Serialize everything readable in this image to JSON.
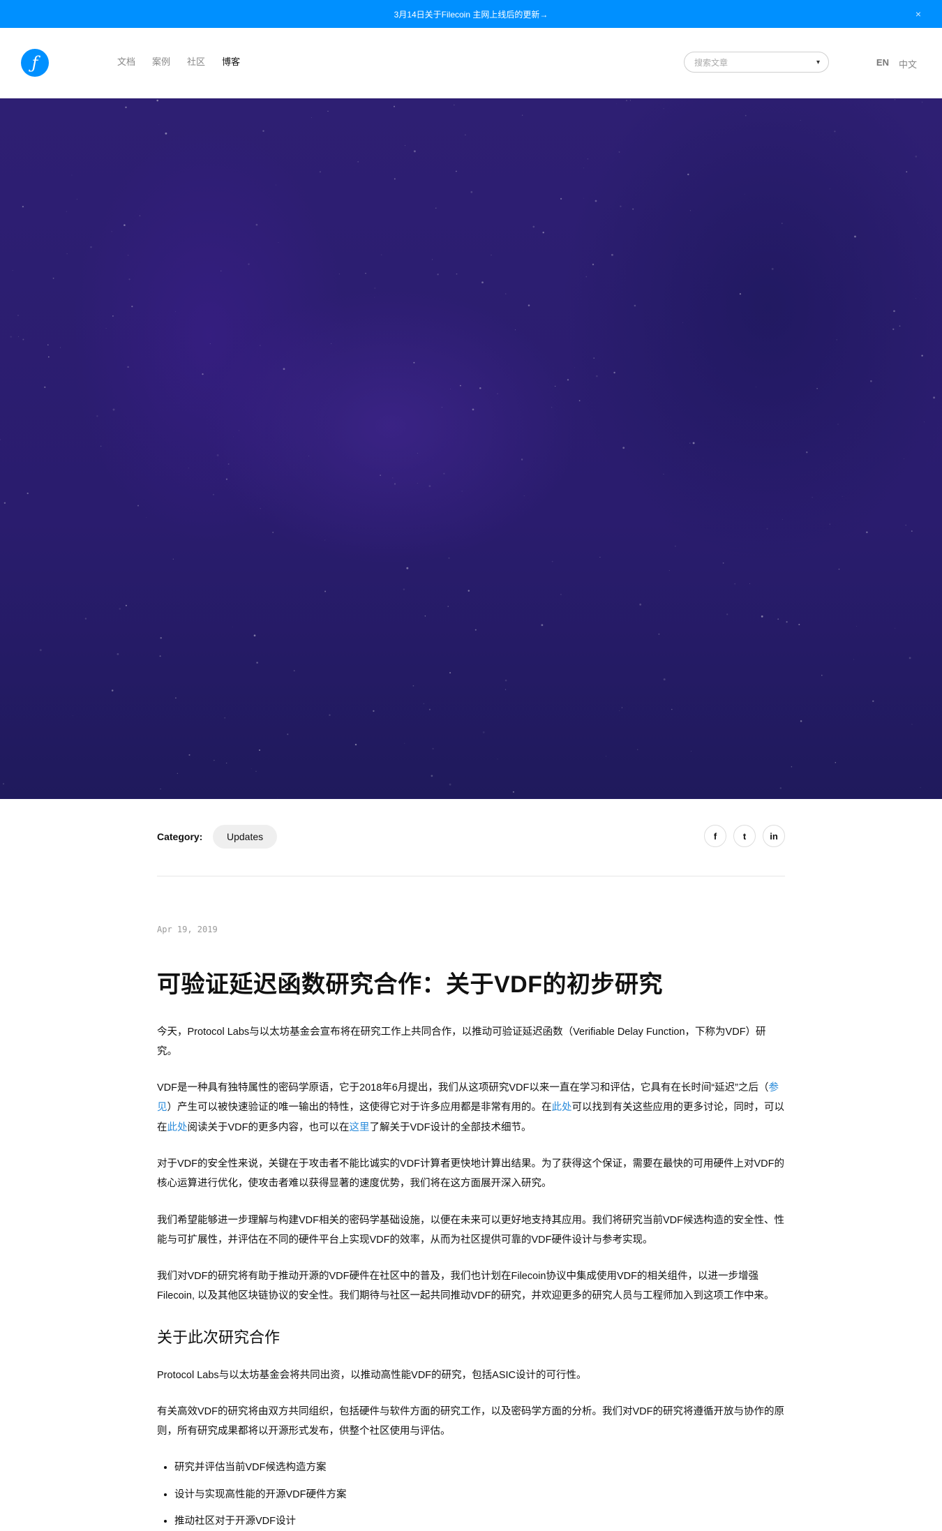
{
  "banner": {
    "text": "3月14日关于Filecoin 主网上线后的更新→",
    "close_glyph": "×"
  },
  "header": {
    "logo_glyph": "ƒ",
    "nav": [
      {
        "label": "文档",
        "active": false
      },
      {
        "label": "案例",
        "active": false
      },
      {
        "label": "社区",
        "active": false
      },
      {
        "label": "博客",
        "active": true
      }
    ],
    "search_placeholder": "搜索文章",
    "search_caret": "▾",
    "lang_en": "EN",
    "lang_zh": "中文"
  },
  "post_meta": {
    "category_label": "Category:",
    "category_value": "Updates",
    "share": {
      "facebook": "f",
      "twitter": "t",
      "linkedin": "in"
    }
  },
  "article": {
    "date": "Apr 19, 2019",
    "title": "可验证延迟函数研究合作：关于VDF的初步研究",
    "p1": "今天，Protocol Labs与以太坊基金会宣布将在研究工作上共同合作，以推动可验证延迟函数（Verifiable Delay Function，下称为VDF）研究。",
    "p2_parts": [
      "VDF是一种具有独特属性的密码学原语，它于2018年6月提出，我们从这项研究VDF以来一直在学习和评估，它具有在长时间“延迟”之后（",
      "参见",
      "）产生可以被快速验证的唯一输出的特性，这使得它对于许多应用都是非常有用的。在",
      "此处",
      "可以找到有关这些应用的更多讨论，同时，可以在",
      "此处",
      "阅读关于VDF的更多内容，也可以在",
      "这里",
      "了解关于VDF设计的全部技术细节。"
    ],
    "p3": "对于VDF的安全性来说，关键在于攻击者不能比诚实的VDF计算者更快地计算出结果。为了获得这个保证，需要在最快的可用硬件上对VDF的核心运算进行优化，使攻击者难以获得显著的速度优势，我们将在这方面展开深入研究。",
    "p4": "我们希望能够进一步理解与构建VDF相关的密码学基础设施，以便在未来可以更好地支持其应用。我们将研究当前VDF候选构造的安全性、性能与可扩展性，并评估在不同的硬件平台上实现VDF的效率，从而为社区提供可靠的VDF硬件设计与参考实现。",
    "p5": "我们对VDF的研究将有助于推动开源的VDF硬件在社区中的普及，我们也计划在Filecoin协议中集成使用VDF的相关组件，以进一步增强Filecoin, 以及其他区块链协议的安全性。我们期待与社区一起共同推动VDF的研究，并欢迎更多的研究人员与工程师加入到这项工作中来。",
    "h2": "关于此次研究合作",
    "p6": "Protocol Labs与以太坊基金会将共同出资，以推动高性能VDF的研究，包括ASIC设计的可行性。",
    "p7": "有关高效VDF的研究将由双方共同组织，包括硬件与软件方面的研究工作，以及密码学方面的分析。我们对VDF的研究将遵循开放与协作的原则，所有研究成果都将以开源形式发布，供整个社区使用与评估。",
    "list": [
      "研究并评估当前VDF候选构造方案",
      "设计与实现高性能的开源VDF硬件方案",
      "推动社区对于开源VDF设计"
    ]
  }
}
